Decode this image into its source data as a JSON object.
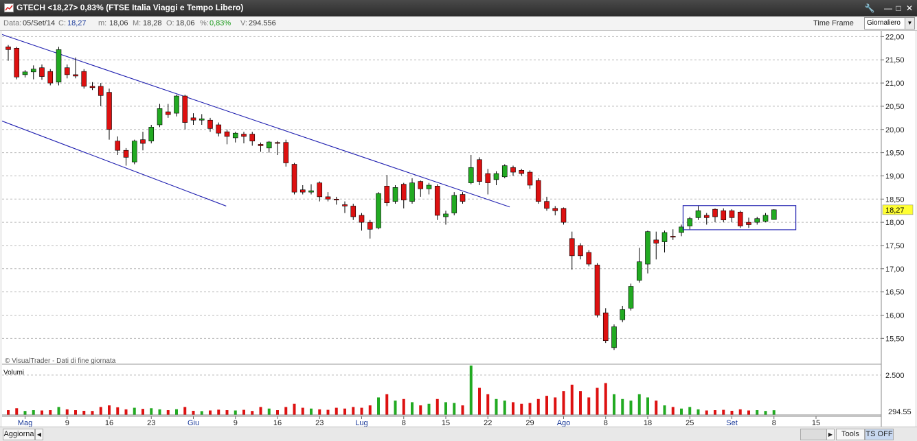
{
  "window": {
    "title": "GTECH <18,27> 0,83%  (FTSE Italia Viaggi e Tempo Libero)"
  },
  "info": {
    "data_label": "Data:",
    "data_value": "05/Set/14",
    "c_label": "C:",
    "c_value": "18,27",
    "m_label": "m:",
    "m_value": "18,06",
    "M_label": "M:",
    "M_value": "18,28",
    "o_label": "O:",
    "o_value": "18,06",
    "pct_label": "%:",
    "pct_value": "0,83%",
    "v_label": "V:",
    "v_value": "294.556",
    "time_frame_label": "Time Frame",
    "time_frame_value": "Giornaliero"
  },
  "colors": {
    "up": "#22aa22",
    "down": "#dd1111",
    "trendline": "#1f1fb0",
    "last_price_bg": "#ffff33"
  },
  "bottom": {
    "aggiorna": "Aggiorna",
    "tools": "Tools",
    "ts_off": "TS OFF"
  },
  "chart_data": {
    "type": "candlestick",
    "copyright": "© VisualTrader - Dati di fine giornata",
    "price_axis_ticks": [
      "22,00",
      "21,50",
      "21,00",
      "20,50",
      "20,00",
      "19,50",
      "19,00",
      "18,50",
      "18,00",
      "17,50",
      "17,00",
      "16,50",
      "16,00",
      "15,50"
    ],
    "ylim": [
      15.18,
      22.05
    ],
    "last_price_label": "18,27",
    "volume_label": "Volumi",
    "volume_ticks": [
      "2.500"
    ],
    "volume_last": "294.55",
    "volume_max": 3100,
    "x_labels": [
      {
        "label": "Mag",
        "idx": 2,
        "month": true
      },
      {
        "label": "9",
        "idx": 7,
        "month": false
      },
      {
        "label": "16",
        "idx": 12,
        "month": false
      },
      {
        "label": "23",
        "idx": 17,
        "month": false
      },
      {
        "label": "Giu",
        "idx": 22,
        "month": true
      },
      {
        "label": "9",
        "idx": 27,
        "month": false
      },
      {
        "label": "16",
        "idx": 32,
        "month": false
      },
      {
        "label": "23",
        "idx": 37,
        "month": false
      },
      {
        "label": "Lug",
        "idx": 42,
        "month": true
      },
      {
        "label": "8",
        "idx": 47,
        "month": false
      },
      {
        "label": "15",
        "idx": 52,
        "month": false
      },
      {
        "label": "22",
        "idx": 57,
        "month": false
      },
      {
        "label": "29",
        "idx": 62,
        "month": false
      },
      {
        "label": "Ago",
        "idx": 66,
        "month": true
      },
      {
        "label": "8",
        "idx": 71,
        "month": false
      },
      {
        "label": "18",
        "idx": 76,
        "month": false
      },
      {
        "label": "25",
        "idx": 81,
        "month": false
      },
      {
        "label": "Set",
        "idx": 86,
        "month": true
      },
      {
        "label": "8",
        "idx": 91,
        "month": false
      },
      {
        "label": "15",
        "idx": 96,
        "month": false
      }
    ],
    "candles": [
      {
        "o": 21.78,
        "c": 21.72,
        "h": 21.82,
        "l": 21.48,
        "v": 300
      },
      {
        "o": 21.75,
        "c": 21.13,
        "h": 21.78,
        "l": 21.08,
        "v": 420
      },
      {
        "o": 21.18,
        "c": 21.24,
        "h": 21.28,
        "l": 21.12,
        "v": 250
      },
      {
        "o": 21.24,
        "c": 21.3,
        "h": 21.38,
        "l": 21.08,
        "v": 300
      },
      {
        "o": 21.33,
        "c": 21.14,
        "h": 21.4,
        "l": 21.07,
        "v": 280
      },
      {
        "o": 21.25,
        "c": 21.0,
        "h": 21.3,
        "l": 20.95,
        "v": 300
      },
      {
        "o": 21.02,
        "c": 21.72,
        "h": 21.78,
        "l": 20.95,
        "v": 500
      },
      {
        "o": 21.33,
        "c": 21.18,
        "h": 21.4,
        "l": 21.1,
        "v": 350
      },
      {
        "o": 21.18,
        "c": 21.15,
        "h": 21.55,
        "l": 21.1,
        "v": 300
      },
      {
        "o": 21.25,
        "c": 20.93,
        "h": 21.3,
        "l": 20.88,
        "v": 260
      },
      {
        "o": 20.93,
        "c": 20.9,
        "h": 21.02,
        "l": 20.85,
        "v": 250
      },
      {
        "o": 20.93,
        "c": 20.73,
        "h": 21.0,
        "l": 20.5,
        "v": 500
      },
      {
        "o": 20.8,
        "c": 20.0,
        "h": 20.88,
        "l": 19.78,
        "v": 600
      },
      {
        "o": 19.75,
        "c": 19.55,
        "h": 19.85,
        "l": 19.45,
        "v": 480
      },
      {
        "o": 19.55,
        "c": 19.4,
        "h": 19.6,
        "l": 19.22,
        "v": 350
      },
      {
        "o": 19.3,
        "c": 19.75,
        "h": 19.78,
        "l": 19.25,
        "v": 450
      },
      {
        "o": 19.78,
        "c": 19.7,
        "h": 19.95,
        "l": 19.55,
        "v": 380
      },
      {
        "o": 19.75,
        "c": 20.05,
        "h": 20.1,
        "l": 19.7,
        "v": 420
      },
      {
        "o": 20.1,
        "c": 20.45,
        "h": 20.55,
        "l": 20.05,
        "v": 350
      },
      {
        "o": 20.38,
        "c": 20.32,
        "h": 20.55,
        "l": 20.25,
        "v": 300
      },
      {
        "o": 20.35,
        "c": 20.72,
        "h": 20.75,
        "l": 20.28,
        "v": 360
      },
      {
        "o": 20.72,
        "c": 20.15,
        "h": 20.75,
        "l": 20.0,
        "v": 500
      },
      {
        "o": 20.25,
        "c": 20.2,
        "h": 20.35,
        "l": 20.1,
        "v": 260
      },
      {
        "o": 20.2,
        "c": 20.23,
        "h": 20.33,
        "l": 20.1,
        "v": 240
      },
      {
        "o": 20.2,
        "c": 20.02,
        "h": 20.25,
        "l": 19.95,
        "v": 280
      },
      {
        "o": 20.1,
        "c": 19.92,
        "h": 20.15,
        "l": 19.85,
        "v": 330
      },
      {
        "o": 19.95,
        "c": 19.85,
        "h": 20.0,
        "l": 19.68,
        "v": 300
      },
      {
        "o": 19.82,
        "c": 19.92,
        "h": 19.95,
        "l": 19.72,
        "v": 280
      },
      {
        "o": 19.9,
        "c": 19.85,
        "h": 19.95,
        "l": 19.7,
        "v": 320
      },
      {
        "o": 19.9,
        "c": 19.75,
        "h": 19.95,
        "l": 19.65,
        "v": 250
      },
      {
        "o": 19.68,
        "c": 19.65,
        "h": 19.72,
        "l": 19.52,
        "v": 500
      },
      {
        "o": 19.6,
        "c": 19.73,
        "h": 19.75,
        "l": 19.5,
        "v": 400
      },
      {
        "o": 19.72,
        "c": 19.7,
        "h": 19.75,
        "l": 19.45,
        "v": 300
      },
      {
        "o": 19.72,
        "c": 19.28,
        "h": 19.78,
        "l": 19.2,
        "v": 500
      },
      {
        "o": 19.25,
        "c": 18.65,
        "h": 19.28,
        "l": 18.6,
        "v": 700
      },
      {
        "o": 18.7,
        "c": 18.65,
        "h": 18.8,
        "l": 18.6,
        "v": 450
      },
      {
        "o": 18.65,
        "c": 18.68,
        "h": 18.82,
        "l": 18.6,
        "v": 400
      },
      {
        "o": 18.85,
        "c": 18.55,
        "h": 18.88,
        "l": 18.45,
        "v": 350
      },
      {
        "o": 18.55,
        "c": 18.5,
        "h": 18.65,
        "l": 18.45,
        "v": 320
      },
      {
        "o": 18.5,
        "c": 18.48,
        "h": 18.55,
        "l": 18.38,
        "v": 450
      },
      {
        "o": 18.38,
        "c": 18.35,
        "h": 18.45,
        "l": 18.2,
        "v": 400
      },
      {
        "o": 18.35,
        "c": 18.12,
        "h": 18.4,
        "l": 18.05,
        "v": 500
      },
      {
        "o": 18.15,
        "c": 18.0,
        "h": 18.2,
        "l": 17.82,
        "v": 450
      },
      {
        "o": 18.0,
        "c": 17.85,
        "h": 18.05,
        "l": 17.65,
        "v": 600
      },
      {
        "o": 17.88,
        "c": 18.62,
        "h": 18.65,
        "l": 17.85,
        "v": 1100
      },
      {
        "o": 18.78,
        "c": 18.42,
        "h": 19.02,
        "l": 18.35,
        "v": 1300
      },
      {
        "o": 18.45,
        "c": 18.75,
        "h": 18.8,
        "l": 18.4,
        "v": 900
      },
      {
        "o": 18.82,
        "c": 18.48,
        "h": 18.85,
        "l": 18.3,
        "v": 1000
      },
      {
        "o": 18.45,
        "c": 18.85,
        "h": 18.95,
        "l": 18.4,
        "v": 800
      },
      {
        "o": 18.88,
        "c": 18.72,
        "h": 18.9,
        "l": 18.55,
        "v": 600
      },
      {
        "o": 18.72,
        "c": 18.8,
        "h": 18.85,
        "l": 18.6,
        "v": 700
      },
      {
        "o": 18.78,
        "c": 18.15,
        "h": 18.82,
        "l": 18.05,
        "v": 1000
      },
      {
        "o": 18.12,
        "c": 18.18,
        "h": 18.25,
        "l": 17.95,
        "v": 800
      },
      {
        "o": 18.2,
        "c": 18.58,
        "h": 18.65,
        "l": 18.15,
        "v": 750
      },
      {
        "o": 18.6,
        "c": 18.45,
        "h": 18.65,
        "l": 18.4,
        "v": 600
      },
      {
        "o": 18.85,
        "c": 19.18,
        "h": 19.45,
        "l": 18.82,
        "v": 3100
      },
      {
        "o": 19.35,
        "c": 18.88,
        "h": 19.4,
        "l": 18.8,
        "v": 1700
      },
      {
        "o": 19.05,
        "c": 18.85,
        "h": 19.15,
        "l": 18.6,
        "v": 1300
      },
      {
        "o": 18.92,
        "c": 19.05,
        "h": 19.1,
        "l": 18.8,
        "v": 1000
      },
      {
        "o": 18.98,
        "c": 19.22,
        "h": 19.25,
        "l": 18.95,
        "v": 900
      },
      {
        "o": 19.18,
        "c": 19.08,
        "h": 19.22,
        "l": 19.0,
        "v": 800
      },
      {
        "o": 19.12,
        "c": 19.05,
        "h": 19.15,
        "l": 19.0,
        "v": 700
      },
      {
        "o": 19.08,
        "c": 18.8,
        "h": 19.12,
        "l": 18.72,
        "v": 750
      },
      {
        "o": 18.9,
        "c": 18.45,
        "h": 18.95,
        "l": 18.4,
        "v": 1000
      },
      {
        "o": 18.45,
        "c": 18.3,
        "h": 18.55,
        "l": 18.25,
        "v": 1200
      },
      {
        "o": 18.3,
        "c": 18.25,
        "h": 18.35,
        "l": 18.15,
        "v": 1100
      },
      {
        "o": 18.3,
        "c": 18.0,
        "h": 18.32,
        "l": 17.95,
        "v": 1500
      },
      {
        "o": 17.65,
        "c": 17.28,
        "h": 17.8,
        "l": 16.98,
        "v": 1900
      },
      {
        "o": 17.5,
        "c": 17.28,
        "h": 17.55,
        "l": 17.2,
        "v": 1500
      },
      {
        "o": 17.35,
        "c": 17.1,
        "h": 17.4,
        "l": 17.05,
        "v": 1100
      },
      {
        "o": 17.08,
        "c": 16.0,
        "h": 17.12,
        "l": 15.95,
        "v": 1700
      },
      {
        "o": 16.05,
        "c": 15.45,
        "h": 16.15,
        "l": 15.4,
        "v": 2000
      },
      {
        "o": 15.3,
        "c": 15.75,
        "h": 15.8,
        "l": 15.25,
        "v": 1300
      },
      {
        "o": 15.9,
        "c": 16.12,
        "h": 16.2,
        "l": 15.85,
        "v": 1000
      },
      {
        "o": 16.15,
        "c": 16.62,
        "h": 16.68,
        "l": 16.1,
        "v": 900
      },
      {
        "o": 16.75,
        "c": 17.15,
        "h": 17.45,
        "l": 16.7,
        "v": 1300
      },
      {
        "o": 17.1,
        "c": 17.8,
        "h": 17.82,
        "l": 16.9,
        "v": 1100
      },
      {
        "o": 17.62,
        "c": 17.55,
        "h": 17.8,
        "l": 17.2,
        "v": 900
      },
      {
        "o": 17.58,
        "c": 17.78,
        "h": 17.82,
        "l": 17.35,
        "v": 600
      },
      {
        "o": 17.7,
        "c": 17.68,
        "h": 17.85,
        "l": 17.62,
        "v": 500
      },
      {
        "o": 17.78,
        "c": 17.9,
        "h": 17.95,
        "l": 17.7,
        "v": 400
      },
      {
        "o": 17.92,
        "c": 18.08,
        "h": 18.12,
        "l": 17.85,
        "v": 500
      },
      {
        "o": 18.1,
        "c": 18.25,
        "h": 18.35,
        "l": 18.05,
        "v": 350
      },
      {
        "o": 18.15,
        "c": 18.1,
        "h": 18.2,
        "l": 17.95,
        "v": 280
      },
      {
        "o": 18.28,
        "c": 18.12,
        "h": 18.3,
        "l": 18.0,
        "v": 300
      },
      {
        "o": 18.25,
        "c": 18.05,
        "h": 18.3,
        "l": 18.0,
        "v": 320
      },
      {
        "o": 18.25,
        "c": 18.1,
        "h": 18.28,
        "l": 18.0,
        "v": 260
      },
      {
        "o": 18.22,
        "c": 17.92,
        "h": 18.25,
        "l": 17.88,
        "v": 350
      },
      {
        "o": 18.0,
        "c": 17.95,
        "h": 18.1,
        "l": 17.88,
        "v": 280
      },
      {
        "o": 18.0,
        "c": 18.08,
        "h": 18.12,
        "l": 17.95,
        "v": 300
      },
      {
        "o": 18.02,
        "c": 18.15,
        "h": 18.2,
        "l": 18.0,
        "v": 250
      },
      {
        "o": 18.06,
        "c": 18.27,
        "h": 18.28,
        "l": 18.06,
        "v": 295
      }
    ],
    "trendlines": [
      {
        "x1": -1.3,
        "y1": 22.08,
        "x2": 59.6,
        "y2": 18.33
      },
      {
        "x1": -1.3,
        "y1": 20.22,
        "x2": 25.9,
        "y2": 18.35
      }
    ],
    "box": {
      "x1": 80.2,
      "x2": 93.6,
      "ylow": 17.84,
      "yhigh": 18.36
    }
  }
}
